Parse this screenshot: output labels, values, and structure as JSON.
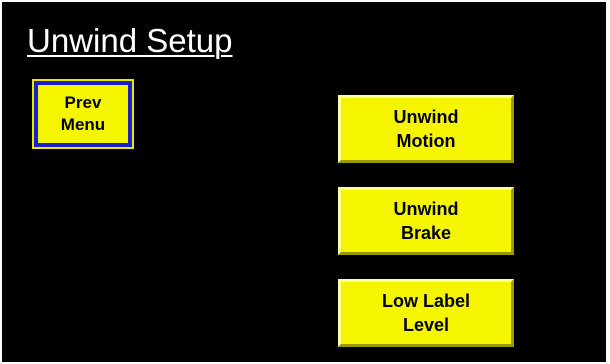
{
  "screen": {
    "title": "Unwind Setup"
  },
  "buttons": {
    "prev_menu": "Prev\nMenu",
    "unwind_motion": "Unwind\nMotion",
    "unwind_brake": "Unwind\nBrake",
    "low_label_level": "Low Label\nLevel"
  },
  "colors": {
    "background": "#000000",
    "button_yellow": "#f5f500",
    "prev_button_border": "#1a20c8",
    "title_text": "#ffffff"
  }
}
